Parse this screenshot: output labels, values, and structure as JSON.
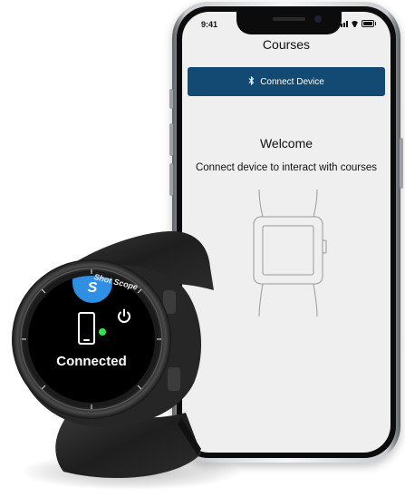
{
  "status_bar": {
    "time": "9:41"
  },
  "nav": {
    "title": "Courses"
  },
  "connect_button": {
    "icon": "bluetooth-icon",
    "label": "Connect Device"
  },
  "welcome": {
    "title": "Welcome",
    "subtitle": "Connect device to interact with courses"
  },
  "watch": {
    "brand": "Shot Scope",
    "badge_letter": "S",
    "status": "Connected",
    "icons": [
      "phone-icon",
      "power-icon"
    ],
    "status_dot_color": "#2ee54a"
  },
  "colors": {
    "accent": "#124a73",
    "badge": "#2f8fe3",
    "screen_bg": "#efefef"
  }
}
